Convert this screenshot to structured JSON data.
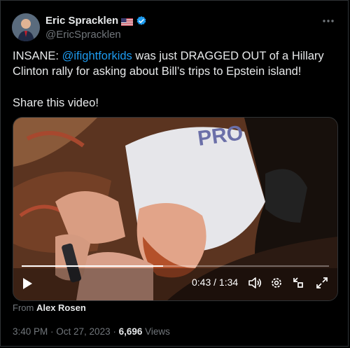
{
  "author": {
    "display_name": "Eric Spracklen",
    "handle": "@EricSpracklen",
    "flag_icon": "us-flag-icon",
    "verified_icon": "verified-badge-icon",
    "verified_color": "#1d9bf0"
  },
  "tweet": {
    "text_before": "INSANE: ",
    "mention": "@ifightforkids",
    "text_after": " was just DRAGGED OUT of a Hillary Clinton rally for asking about Bill’s trips to Epstein island!",
    "share_line": "Share this video!"
  },
  "video": {
    "current_time": "0:43",
    "separator": " / ",
    "duration": "1:34",
    "progress_fraction": 0.46,
    "controls": [
      "play-icon",
      "volume-icon",
      "settings-icon",
      "minimize-icon",
      "fullscreen-icon"
    ]
  },
  "attribution": {
    "prefix": "From",
    "source": "Alex Rosen"
  },
  "meta": {
    "time": "3:40 PM",
    "dot": " · ",
    "date": "Oct 27, 2023",
    "views_count": "6,696",
    "views_label": "Views"
  },
  "colors": {
    "background": "#000000",
    "text": "#e7e9ea",
    "secondary": "#71767b",
    "link": "#1d9bf0"
  }
}
